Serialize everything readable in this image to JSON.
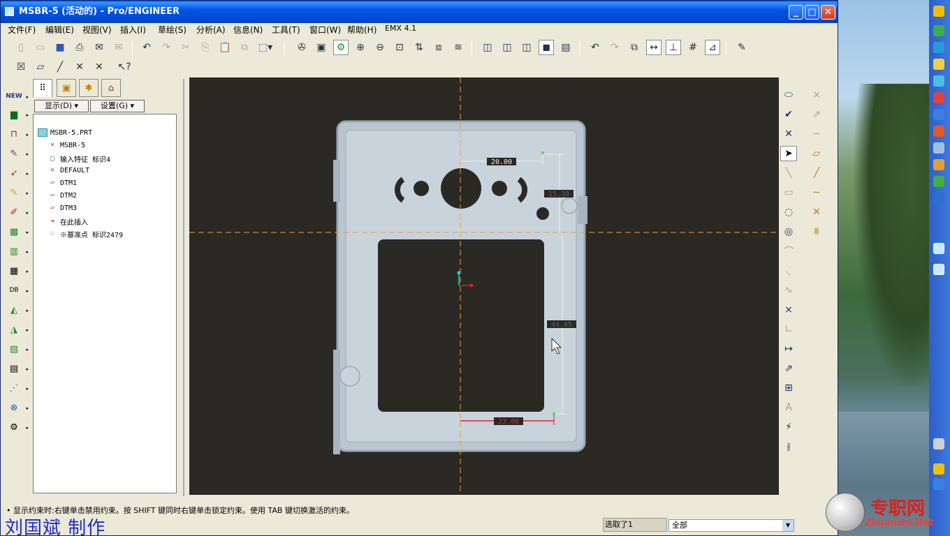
{
  "window": {
    "title": "MSBR-5 (活动的) - Pro/ENGINEER",
    "minimize": "0",
    "maximize": "1",
    "close": "r"
  },
  "menu": [
    {
      "label": "文件(F)"
    },
    {
      "label": "编辑(E)"
    },
    {
      "label": "视图(V)"
    },
    {
      "label": "插入(I)"
    },
    {
      "label": "草绘(S)"
    },
    {
      "label": "分析(A)"
    },
    {
      "label": "信息(N)"
    },
    {
      "label": "工具(T)"
    },
    {
      "label": "窗口(W)"
    },
    {
      "label": "帮助(H)"
    },
    {
      "label": "EMX 4.1"
    }
  ],
  "panel": {
    "show_button": "显示(D)",
    "settings_button": "设置(G)"
  },
  "tree": [
    {
      "label": "MSBR-5.PRT",
      "icon": "part-icon"
    },
    {
      "label": "MSBR-5",
      "icon": "csys-icon"
    },
    {
      "label": "输入特征 标识4",
      "icon": "import-feature-icon"
    },
    {
      "label": "DEFAULT",
      "icon": "csys-icon"
    },
    {
      "label": "DTM1",
      "icon": "datum-plane-icon"
    },
    {
      "label": "DTM2",
      "icon": "datum-plane-icon"
    },
    {
      "label": "DTM3",
      "icon": "datum-plane-icon"
    },
    {
      "label": "在此插入",
      "icon": "insert-here-arrow-icon"
    },
    {
      "label": "※基准点 标识2479",
      "icon": "datum-point-icon"
    }
  ],
  "dimensions": {
    "d1": "20.00",
    "d2": "15.38",
    "d3": "44.05",
    "d4": "23.00"
  },
  "status": {
    "message": "• 显示约束时:右键单击禁用约束。按 SHIFT 键同时右键单击锁定约束。使用 TAB 键切换激活的约束。",
    "selected": "选取了1",
    "filter": "全部"
  },
  "overlay": {
    "author": "刘国斌 制作",
    "watermark_cn": "专职网",
    "watermark_en": "Zhuanzhi.Net"
  },
  "colors": {
    "canvas_bg": "#2b2924",
    "part_color": "#b9c6d0",
    "dimension_strong": "#e02020",
    "centerline": "#e8a040"
  }
}
